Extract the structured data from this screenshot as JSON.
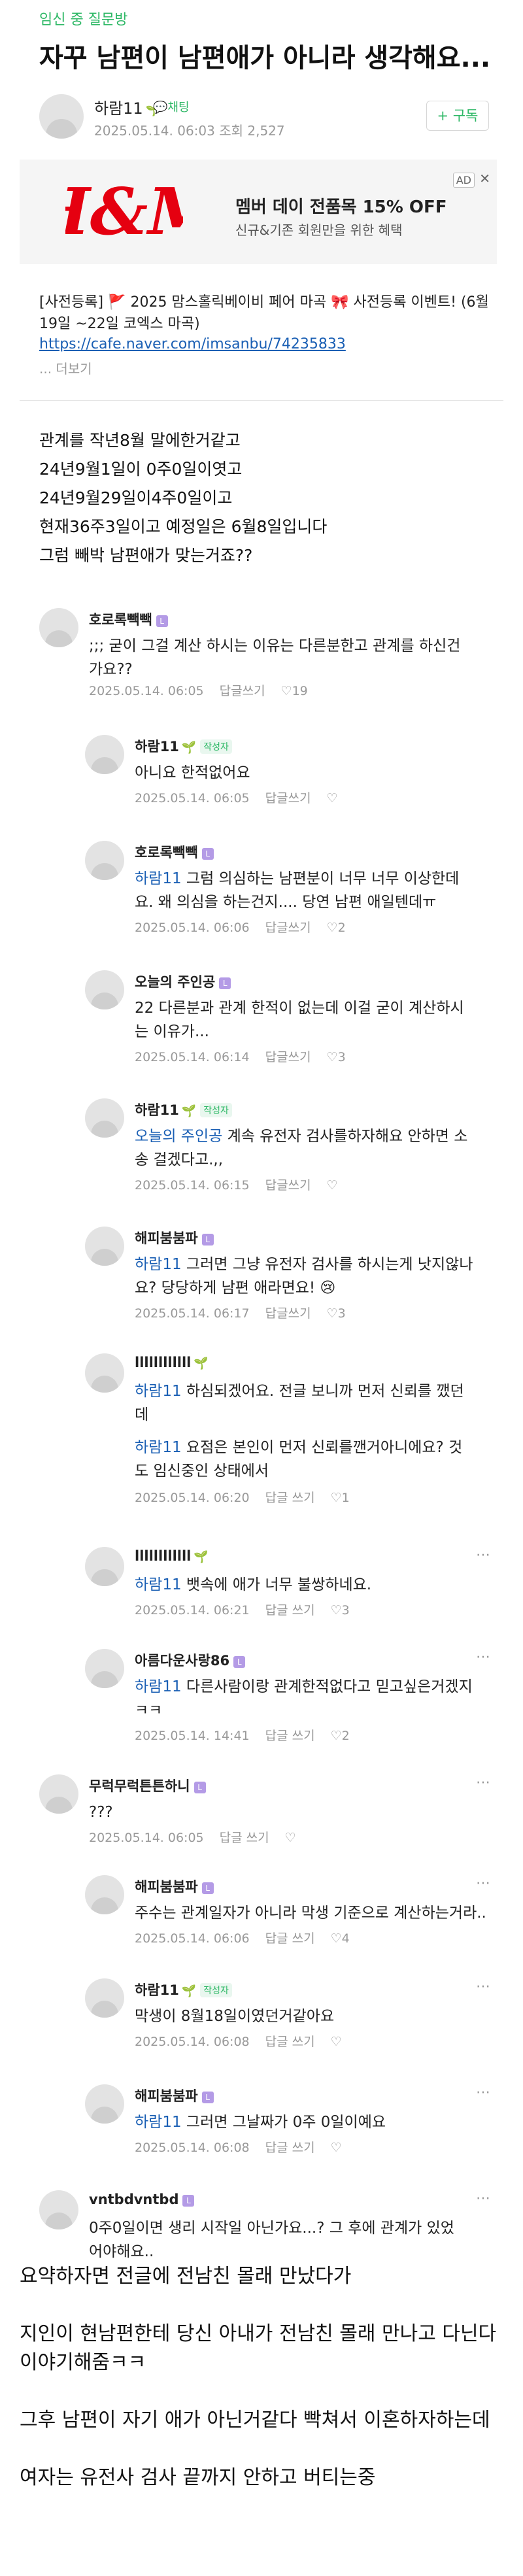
{
  "board": "임신 중 질문방",
  "title": "자꾸 남편이 남편애가 아니라 생각해요...",
  "author": {
    "name": "하람11",
    "chat_label": "채팅",
    "meta": "2025.05.14. 06:03 조회 2,527",
    "follow": "+ 구독"
  },
  "ad": {
    "brand": "H&M",
    "title": "멤버 데이 전품목 15% OFF",
    "subtitle": "신규&기존 회원만을 위한 혜택",
    "badge": "AD",
    "close": "✕"
  },
  "notice": {
    "text": "[사전등록] 🚩 2025 맘스홀릭베이비 페어 마곡 🎀 사전등록 이벤트! (6월 19일 ~22일 코엑스 마곡)",
    "link": "https://cafe.naver.com/imsanbu/74235833",
    "more": "... 더보기"
  },
  "post_lines": [
    "관계를 작년8월 말에한거같고",
    "24년9월1일이 0주0일이엿고",
    "24년9월29일이4주0일이고",
    "현재36주3일이고 예정일은 6월8일입니다",
    "그럼 빼박 남편애가 맞는거죠??"
  ],
  "comments": [
    {
      "name": "호로록빽빽",
      "text_lines": [
        ";;; 굳이 그걸 계산 하시는 이유는 다른분한고 관계를 하신건가요??"
      ],
      "date": "2025.05.14. 06:05",
      "reply": "답글쓰기",
      "likes": "19"
    },
    {
      "name": "하람11",
      "badge": "작성자",
      "text_lines": [
        "아니요 한적없어요"
      ],
      "date": "2025.05.14. 06:05",
      "reply": "답글쓰기",
      "likes": ""
    },
    {
      "name": "호로록빽빽",
      "mention": "하람11",
      "text_lines": [
        "그럼 의심하는 남편분이 너무 너무 이상한데요. 왜 의심을 하는건지.... 당연 남편 애일텐데ㅠ"
      ],
      "date": "2025.05.14. 06:06",
      "reply": "답글쓰기",
      "likes": "2"
    },
    {
      "name": "오늘의 주인공",
      "text_lines": [
        "22 다른분과 관계 한적이 없는데 이걸 굳이 계산하시는 이유가..."
      ],
      "date": "2025.05.14. 06:14",
      "reply": "답글쓰기",
      "likes": "3"
    },
    {
      "name": "하람11",
      "badge": "작성자",
      "mention": "오늘의 주인공",
      "text_lines": [
        "계속 유전자 검사를하자해요 안하면 소송 걸겠다고.,,"
      ],
      "date": "2025.05.14. 06:15",
      "reply": "답글쓰기",
      "likes": ""
    },
    {
      "name": "해피붐붐파",
      "mention": "하람11",
      "text_lines": [
        "그러면 그냥 유전자 검사를 하시는게 낫지않나요? 당당하게 남편 애라면요! 😢"
      ],
      "date": "2025.05.14. 06:17",
      "reply": "답글쓰기",
      "likes": "3"
    },
    {
      "name": "llllllllllll",
      "mention": "하람11",
      "text_lines": [
        "하심되겠어요. 전글 보니까 먼저 신뢰를 깼던데"
      ],
      "date": "",
      "reply": "",
      "likes": ""
    },
    {
      "name": "",
      "mention": "하람11",
      "text_lines": [
        "요점은 본인이 먼저 신뢰를깬거아니에요? 것도 임신중인 상태에서"
      ],
      "date": "2025.05.14. 06:20",
      "reply": "답글 쓰기",
      "likes": "1"
    },
    {
      "name": "llllllllllll",
      "mention": "하람11",
      "text_lines": [
        "뱃속에 애가 너무 불쌍하네요."
      ],
      "date": "2025.05.14. 06:21",
      "reply": "답글 쓰기",
      "likes": "3"
    },
    {
      "name": "아름다운사랑86",
      "mention": "하람11",
      "text_lines": [
        "다른사람이랑 관계한적없다고 믿고싶은거겠지ㅋㅋ"
      ],
      "date": "2025.05.14. 14:41",
      "reply": "답글 쓰기",
      "likes": "2"
    },
    {
      "name": "무럭무럭튼튼하니",
      "text_lines": [
        "???"
      ],
      "date": "2025.05.14. 06:05",
      "reply": "답글 쓰기",
      "likes": ""
    },
    {
      "name": "해피붐붐파",
      "text_lines": [
        "주수는 관계일자가 아니라 막생 기준으로 계산하는거라.."
      ],
      "date": "2025.05.14. 06:06",
      "reply": "답글 쓰기",
      "likes": "4"
    },
    {
      "name": "하람11",
      "badge": "작성자",
      "text_lines": [
        "막생이 8월18일이였던거같아요"
      ],
      "date": "2025.05.14. 06:08",
      "reply": "답글 쓰기",
      "likes": ""
    },
    {
      "name": "해피붐붐파",
      "mention": "하람11",
      "text_lines": [
        "그러면 그날짜가 0주 0일이예요"
      ],
      "date": "2025.05.14. 06:08",
      "reply": "답글 쓰기",
      "likes": ""
    },
    {
      "name": "vntbdvntbd",
      "text_lines": [
        "0주0일이면 생리 시작일 아닌가요...? 그 후에 관계가 있었어야해요.."
      ],
      "date": "",
      "reply": "",
      "likes": ""
    }
  ],
  "summary": [
    "요약하자면 전글에 전남친 몰래 만났다가",
    "지인이 현남편한테 당신 아내가 전남친 몰래 만나고 다닌다 이야기해줌ㅋㅋ",
    "그후 남편이 자기 애가 아닌거같다 빡쳐서 이혼하자하는데",
    "여자는 유전사 검사 끝까지 안하고 버티는중"
  ]
}
